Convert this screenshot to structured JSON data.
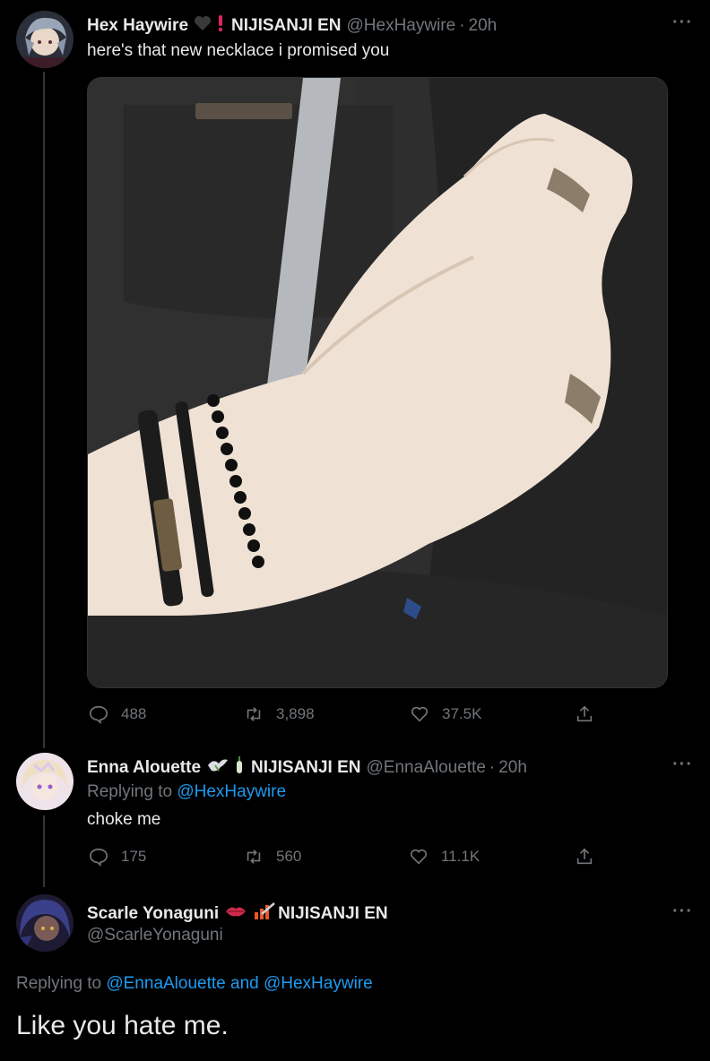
{
  "tweet1": {
    "display_name": "Hex Haywire",
    "affiliation": "NIJISANJI EN",
    "handle": "@HexHaywire",
    "time": "20h",
    "text": "here's that new necklace i promised you",
    "stats": {
      "replies": "488",
      "retweets": "3,898",
      "likes": "37.5K"
    }
  },
  "tweet2": {
    "display_name": "Enna Alouette",
    "affiliation": "NIJISANJI EN",
    "handle": "@EnnaAlouette",
    "time": "20h",
    "replying_prefix": "Replying to",
    "replying_to": "@HexHaywire",
    "text": "choke me",
    "stats": {
      "replies": "175",
      "retweets": "560",
      "likes": "11.1K"
    }
  },
  "tweet3": {
    "display_name": "Scarle Yonaguni",
    "affiliation": "NIJISANJI EN",
    "handle": "@ScarleYonaguni",
    "replying_prefix": "Replying to",
    "replying_to": "@EnnaAlouette and @HexHaywire",
    "text": "Like you hate me."
  },
  "more_label": "···",
  "dot": "·",
  "colors": {
    "background": "#000000",
    "text": "#e7e9ea",
    "muted": "#71767b",
    "link": "#1d9bf0"
  },
  "icons": [
    "reply-icon",
    "retweet-icon",
    "like-icon",
    "share-icon",
    "more-icon"
  ]
}
